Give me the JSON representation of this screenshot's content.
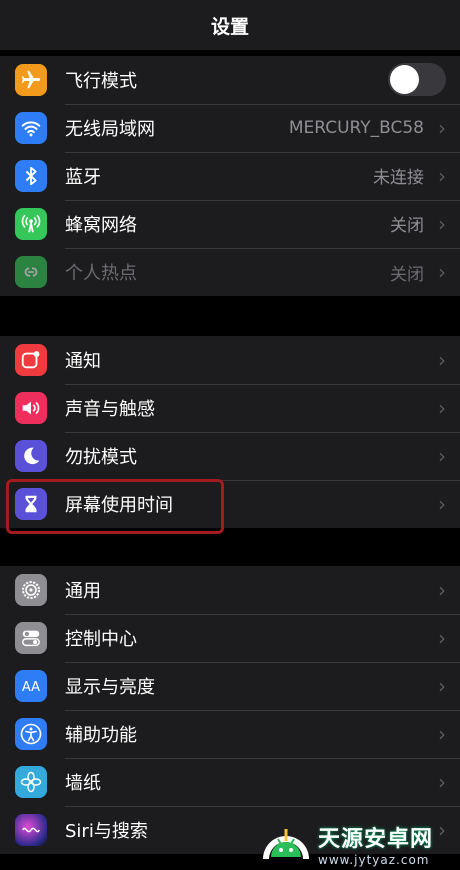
{
  "header": {
    "title": "设置"
  },
  "groups": [
    {
      "rows": [
        {
          "label": "飞行模式",
          "icon": "airplane-icon",
          "color": "#f29a1c",
          "toggle_on": false
        },
        {
          "label": "无线局域网",
          "value": "MERCURY_BC58",
          "icon": "wifi-icon",
          "color": "#2f7df6"
        },
        {
          "label": "蓝牙",
          "value": "未连接",
          "icon": "bluetooth-icon",
          "color": "#2f7df6"
        },
        {
          "label": "蜂窝网络",
          "value": "关闭",
          "icon": "cellular-icon",
          "color": "#35c759"
        },
        {
          "label": "个人热点",
          "value": "关闭",
          "icon": "hotspot-icon",
          "color": "#35c759"
        }
      ]
    },
    {
      "rows": [
        {
          "label": "通知",
          "icon": "notifications-icon",
          "color": "#ef3b3f"
        },
        {
          "label": "声音与触感",
          "icon": "sound-icon",
          "color": "#ee2f5d"
        },
        {
          "label": "勿扰模式",
          "icon": "moon-icon",
          "color": "#5b51d8"
        },
        {
          "label": "屏幕使用时间",
          "icon": "hourglass-icon",
          "color": "#5b51d8"
        }
      ]
    },
    {
      "rows": [
        {
          "label": "通用",
          "icon": "gear-icon",
          "color": "#8e8e93"
        },
        {
          "label": "控制中心",
          "icon": "switches-icon",
          "color": "#8e8e93"
        },
        {
          "label": "显示与亮度",
          "icon": "display-aa-icon",
          "color": "#2f7df6"
        },
        {
          "label": "辅助功能",
          "icon": "accessibility-icon",
          "color": "#2f7df6"
        },
        {
          "label": "墙纸",
          "icon": "wallpaper-icon",
          "color": "#33a9dc"
        },
        {
          "label": "Siri与搜索",
          "icon": "siri-icon",
          "color": "#222"
        }
      ]
    }
  ],
  "watermark": {
    "name": "天源安卓网",
    "url": "www.jytyaz.com"
  }
}
